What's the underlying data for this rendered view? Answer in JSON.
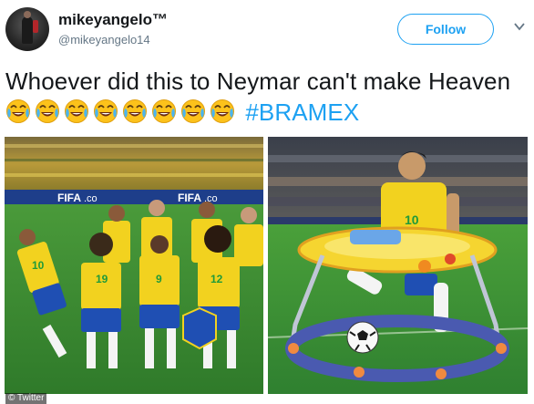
{
  "author": {
    "display_name": "mikeyangelo™",
    "handle": "@mikeyangelo14"
  },
  "follow_button": {
    "label": "Follow"
  },
  "tweet": {
    "text_before": "Whoever did this to Neymar can't make Heaven",
    "emoji": "face-with-tears-of-joy",
    "emoji_count": 8,
    "hashtag": "#BRAMEX"
  },
  "media": {
    "left_banner_left": "FIFA",
    "left_banner_left_suffix": ".co",
    "left_banner_right": "FIFA",
    "left_banner_right_suffix": ".co",
    "jersey_numbers": [
      "10",
      "19",
      "9",
      "12",
      "10"
    ],
    "walker_player_number": "10"
  },
  "watermark": "© Twitter",
  "colors": {
    "brand": "#1da1f2",
    "text": "#14171a",
    "muted": "#657786",
    "brazil_yellow": "#f2d21f",
    "brazil_blue": "#1f4fb3",
    "pitch_green": "#3b8a3a"
  }
}
